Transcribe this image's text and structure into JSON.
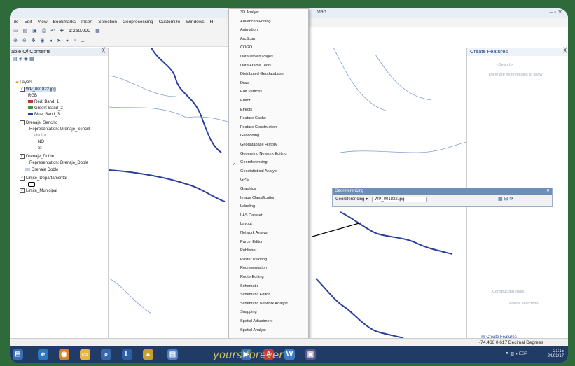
{
  "window": {
    "title": "Map",
    "controls": "– ▫ ✕"
  },
  "menubar": [
    "ile",
    "Edit",
    "View",
    "Bookmarks",
    "Insert",
    "Selection",
    "Geoprocessing",
    "Customize",
    "Windows",
    "H"
  ],
  "toolbar": {
    "scale": "1:250.000"
  },
  "toc": {
    "title": "able Of Contents",
    "close": "╳",
    "layers_root": "Layers",
    "items": [
      {
        "label": "WP_001822.jpg",
        "checked": true
      },
      {
        "label": "RGB"
      },
      {
        "label": "Red:  Band_1",
        "color": "#c83232"
      },
      {
        "label": "Green: Band_2",
        "color": "#3c9a3c"
      },
      {
        "label": "Blue:  Band_3",
        "color": "#2a3fa0"
      },
      {
        "label": "Drenaje_Sencillo",
        "checked": false
      },
      {
        "label": "Representation: Drenaje_Sencill"
      },
      {
        "label": "<Null>"
      },
      {
        "label": "NO"
      },
      {
        "label": "SI"
      },
      {
        "label": "Drenaje_Doble",
        "checked": true
      },
      {
        "label": "Representation: Drenaje_Doble"
      },
      {
        "label": "Drenaje Doble",
        "color": "#b9cfee"
      },
      {
        "label": "Limite_Departamental",
        "checked": true
      },
      {
        "label": "Limite_Municipal",
        "checked": true
      }
    ]
  },
  "menu": {
    "items": [
      "3D Analyst",
      "Advanced Editing",
      "Animation",
      "ArcScan",
      "COGO",
      "Data Driven Pages",
      "Data Frame Tools",
      "Distributed Geodatabase",
      "Draw",
      "Edit Vertices",
      "Editor",
      "Effects",
      "Feature Cache",
      "Feature Construction",
      "Geocoding",
      "Geodatabase History",
      "Geometric Network Editing",
      "Georeferencing",
      "Geostatistical Analyst",
      "GPS",
      "Graphics",
      "Image Classification",
      "Labeling",
      "LAS Dataset",
      "Layout",
      "Network Analyst",
      "Parcel Editor",
      "Publisher",
      "Raster Painting",
      "Representation",
      "Route Editing",
      "Schematic",
      "Schematic Editor",
      "Schematic Network Analyst",
      "Snapping",
      "Spatial Adjustment",
      "Spatial Analyst"
    ],
    "checked_item": "Georeferencing",
    "more_arrow": "▾"
  },
  "create_features": {
    "title": "Create Features",
    "close": "╳",
    "hint_top": "<Search>",
    "hint_line": "There are no templates to show",
    "construction_tools": "Construction Tools",
    "construction_hint": "<None selected>",
    "bottom_tab": "Create Features"
  },
  "georef": {
    "title": "Georeferencing",
    "close": "✕",
    "dropdown": "Georeferencing ▾",
    "layer_field": "WP_001822.jpg"
  },
  "status": {
    "coords": "-74,466  0,617 Decimal Degrees"
  },
  "taskbar": {
    "watermark": "yours forever",
    "lang": "ESP",
    "time": "21:15",
    "date": "24/03/17"
  }
}
